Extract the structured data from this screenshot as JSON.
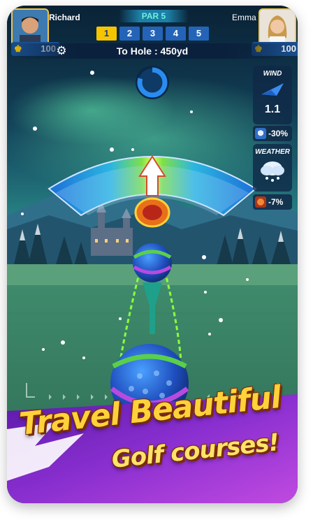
{
  "players": {
    "left": {
      "name": "Richard",
      "score": "100"
    },
    "right": {
      "name": "Emma",
      "score": "100"
    }
  },
  "hole_info": {
    "par": "PAR 5",
    "holes": [
      "1",
      "2",
      "3",
      "4",
      "5"
    ],
    "active_hole": "1",
    "to_hole": "To Hole : 450yd"
  },
  "wind": {
    "title": "WIND",
    "speed": "1.1",
    "bonus": "-30%"
  },
  "weather": {
    "title": "WEATHER",
    "condition_icon": "snow-cloud-icon",
    "bonus": "-7%"
  },
  "timer_progress": 0.8,
  "promo": {
    "line1": "Travel Beautiful",
    "line2": "Golf courses!"
  },
  "colors": {
    "accent_yellow": "#f7c400",
    "hud_blue": "#2464b8",
    "promo_purple": "#8a2fd0"
  }
}
